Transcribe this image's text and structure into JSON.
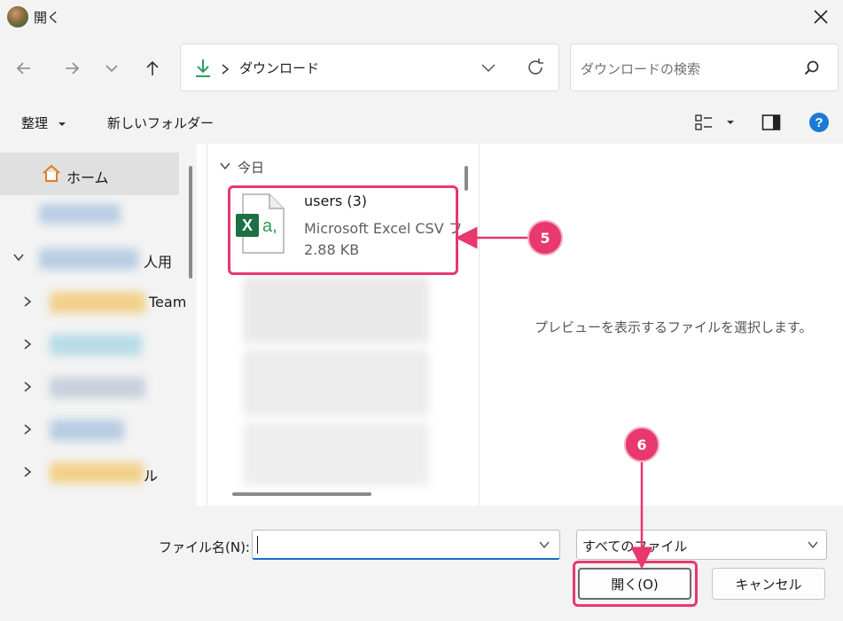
{
  "window": {
    "title": "開く",
    "icons": [
      "app-icon",
      "close-icon"
    ]
  },
  "nav": {
    "breadcrumb": "ダウンロード",
    "search_placeholder": "ダウンロードの検索",
    "icons": [
      "back-arrow-icon",
      "forward-arrow-icon",
      "chevron-down-icon",
      "up-arrow-icon",
      "download-icon",
      "chevron-right-icon",
      "refresh-icon",
      "search-icon"
    ]
  },
  "toolbar": {
    "organize_label": "整理",
    "new_folder_label": "新しいフォルダー",
    "icons": [
      "dropdown-caret-icon",
      "view-options-icon",
      "preview-pane-icon",
      "help-icon"
    ]
  },
  "sidebar": {
    "home_label": "ホーム",
    "personal_suffix": "人用",
    "teams_suffix": "Team",
    "folder_suffix": "ル",
    "icons": [
      "home-icon",
      "chevron-down-icon",
      "chevron-right-icon"
    ]
  },
  "files": {
    "group_header": "今日",
    "item": {
      "name": "users (3)",
      "type": "Microsoft Excel CSV フ",
      "size": "2.88 KB",
      "icon_text": "X a,",
      "icon": "excel-csv-file-icon"
    }
  },
  "preview": {
    "message": "プレビューを表示するファイルを選択します。"
  },
  "footer": {
    "filename_label": "ファイル名(N):",
    "filename_value": "",
    "filetype_value": "すべてのファイル",
    "open_label": "開く(O)",
    "cancel_label": "キャンセル"
  },
  "annotations": [
    {
      "number": "5",
      "target": "file-item-users"
    },
    {
      "number": "6",
      "target": "open-button"
    }
  ],
  "colors": {
    "accent": "#e8386d",
    "excel": "#1d7044",
    "help": "#1c7ad6",
    "download": "#2a9d5f"
  }
}
